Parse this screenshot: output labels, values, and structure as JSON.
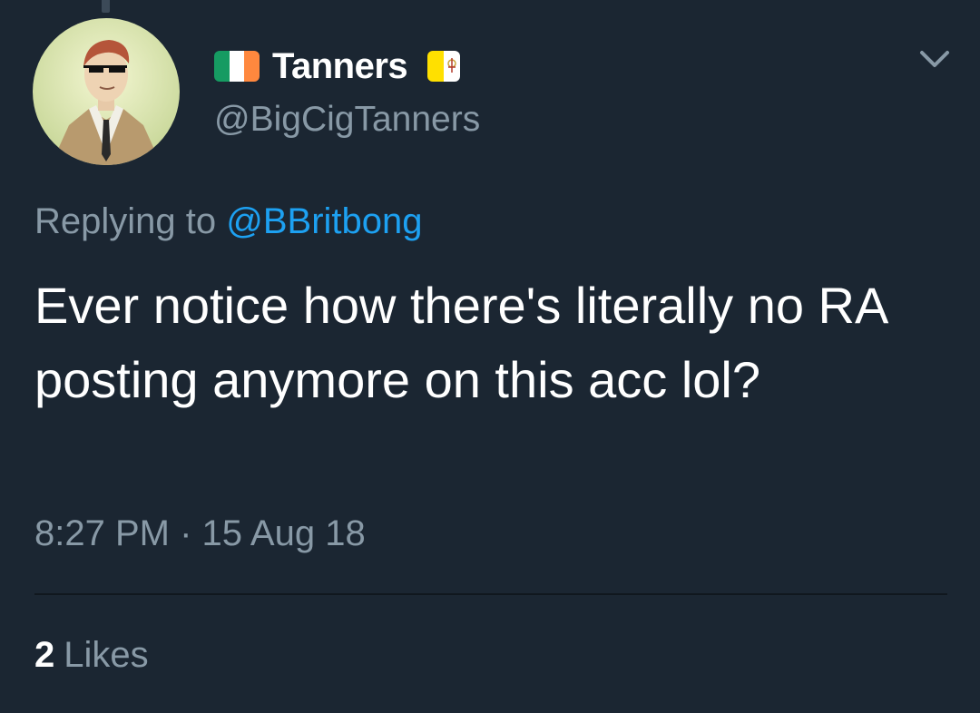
{
  "tweet": {
    "display_name": "Tanners",
    "handle": "@BigCigTanners",
    "replying_prefix": "Replying to",
    "reply_mention": "@BBritbong",
    "text": "Ever notice how there's literally no RA posting anymore on this acc lol?",
    "timestamp": "8:27 PM · 15 Aug 18",
    "likes_count": "2",
    "likes_label": "Likes"
  },
  "icons": {
    "name_flag_left": "irish-flag-icon",
    "name_flag_right": "vatican-flag-icon",
    "menu": "chevron-down-icon",
    "avatar": "avatar"
  },
  "colors": {
    "background": "#1b2632",
    "text": "#ffffff",
    "secondary_text": "#8899a6",
    "link": "#1da1f2",
    "irish_green": "#169b62",
    "irish_orange": "#ff883e",
    "vatican_yellow": "#ffe000"
  }
}
